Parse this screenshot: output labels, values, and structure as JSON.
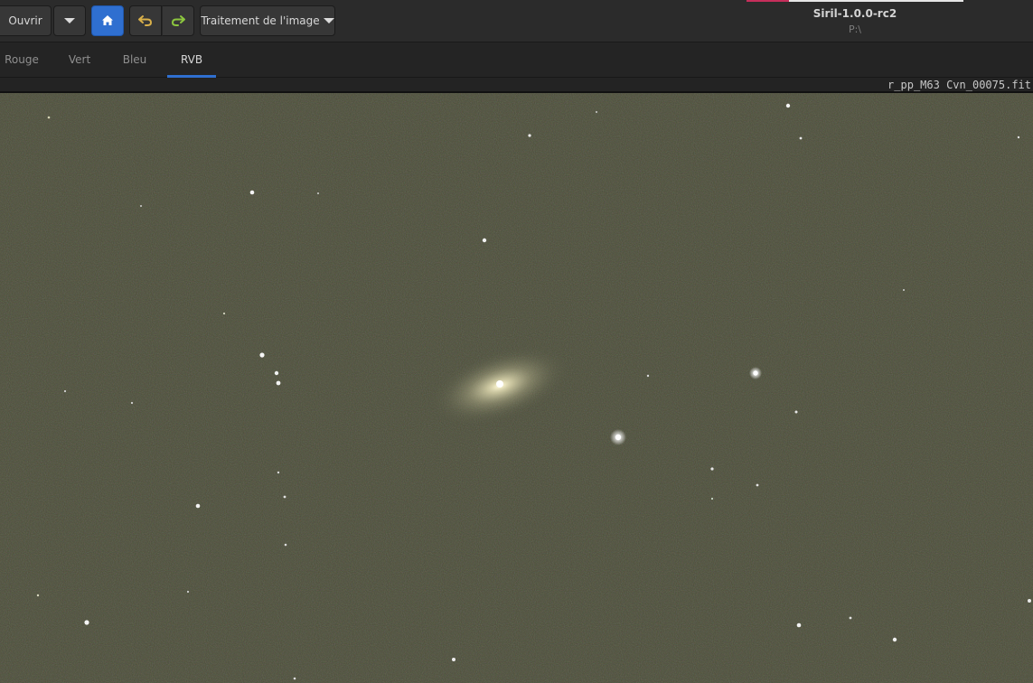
{
  "header": {
    "open_label": "Ouvrir",
    "process_label": "Traitement de l'image",
    "app_title": "Siril-1.0.0-rc2",
    "app_path": "P:\\",
    "icons": {
      "open_menu": "chevron-down-icon",
      "home": "home-icon",
      "undo": "undo-icon",
      "redo": "redo-icon"
    },
    "colors": {
      "accent": "#2f6fd0",
      "undo": "#d9b04a",
      "redo": "#8cc63f",
      "title_accent": "#c62e5b"
    }
  },
  "tabs": {
    "items": [
      {
        "label": "Rouge"
      },
      {
        "label": "Vert"
      },
      {
        "label": "Bleu"
      },
      {
        "label": "RVB",
        "active": true
      }
    ]
  },
  "viewer": {
    "filename": "r_pp_M63 Cvn_00075.fit"
  }
}
